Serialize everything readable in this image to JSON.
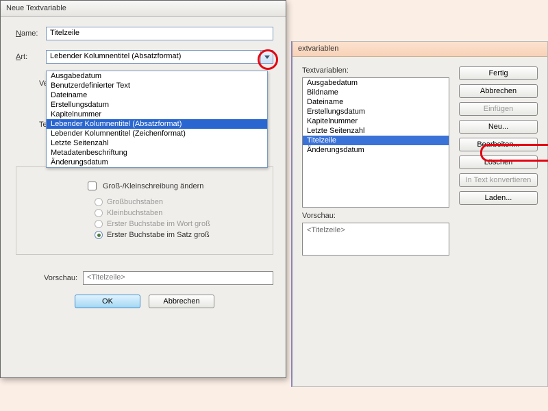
{
  "back": {
    "title_suffix": "extvariablen",
    "list_label": "Textvariablen:",
    "items": [
      "Ausgabedatum",
      "Bildname",
      "Dateiname",
      "Erstellungsdatum",
      "Kapitelnummer",
      "Letzte Seitenzahl",
      "Titelzeile",
      "Änderungsdatum"
    ],
    "selected_index": 6,
    "preview_label": "Vorschau:",
    "preview_value": "<Titelzeile>",
    "buttons": {
      "done": "Fertig",
      "cancel": "Abbrechen",
      "insert": "Einfügen",
      "new": "Neu...",
      "edit": "Bearbeiten...",
      "delete": "Löschen",
      "convert": "In Text konvertieren",
      "load": "Laden..."
    }
  },
  "dialog": {
    "title": "Neue Textvariable",
    "name_label": "Name:",
    "name_value": "Titelzeile",
    "art_label": "Art:",
    "art_value": "Lebender Kolumnentitel (Absatzformat)",
    "hidden_v": "Ve",
    "hidden_t": "Te",
    "dropdown": {
      "options": [
        "Ausgabedatum",
        "Benutzerdefinierter Text",
        "Dateiname",
        "Erstellungsdatum",
        "Kapitelnummer",
        "Lebender Kolumnentitel (Absatzformat)",
        "Lebender Kolumnentitel (Zeichenformat)",
        "Letzte Seitenzahl",
        "Metadatenbeschriftung",
        "Änderungsdatum"
      ],
      "selected_index": 5
    },
    "options": {
      "change_case": "Groß-/Kleinschreibung ändern",
      "upper": "Großbuchstaben",
      "lower": "Kleinbuchstaben",
      "word": "Erster Buchstabe im Wort groß",
      "sentence": "Erster Buchstabe im Satz groß"
    },
    "preview_label": "Vorschau:",
    "preview_value": "<Titelzeile>",
    "ok": "OK",
    "cancel": "Abbrechen"
  }
}
